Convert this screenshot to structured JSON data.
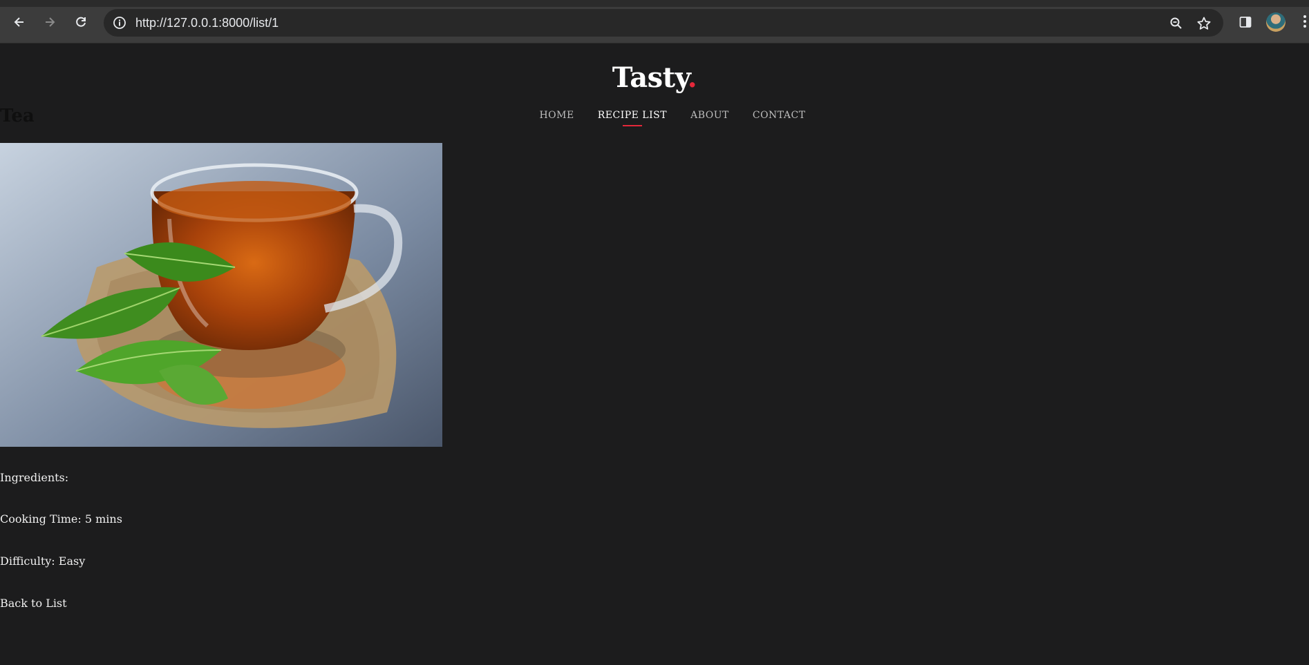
{
  "browser": {
    "url": "http://127.0.0.1:8000/list/1"
  },
  "site": {
    "logo_text": "Tasty",
    "logo_dot": ".",
    "nav": [
      {
        "label": "HOME",
        "active": false
      },
      {
        "label": "RECIPE LIST",
        "active": true
      },
      {
        "label": "ABOUT",
        "active": false
      },
      {
        "label": "CONTACT",
        "active": false
      }
    ],
    "accent_color": "#e5283a"
  },
  "recipe": {
    "title": "Tea",
    "ingredients_label": "Ingredients:",
    "cooking_time": "Cooking Time: 5 mins",
    "difficulty": "Difficulty: Easy",
    "back_link": "Back to List"
  }
}
